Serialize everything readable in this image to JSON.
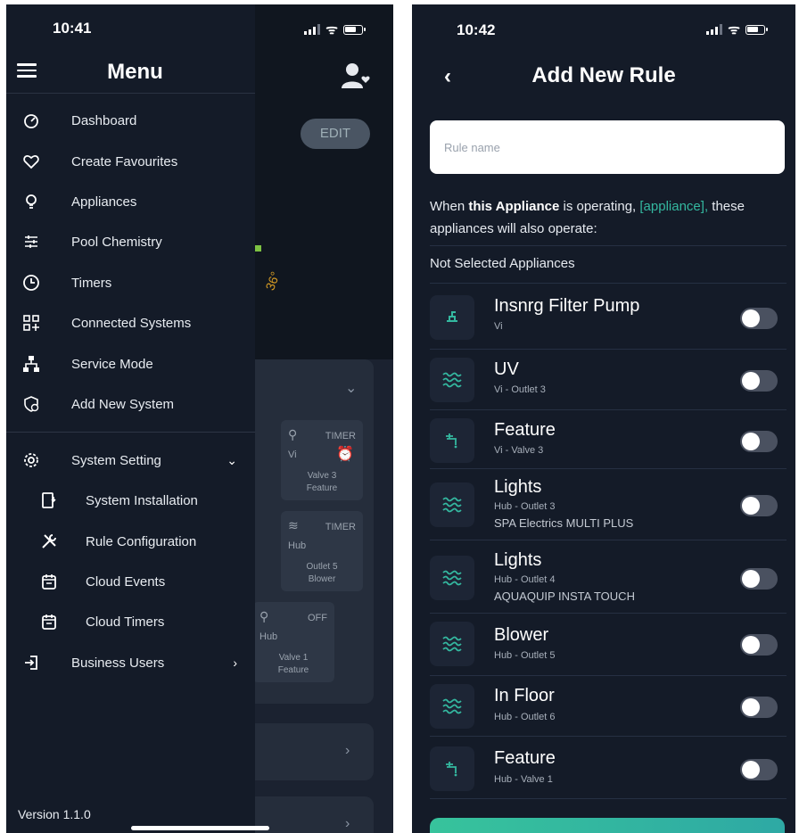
{
  "left_phone": {
    "status_time": "10:41",
    "menu": {
      "title": "Menu",
      "items": [
        {
          "label": "Dashboard",
          "icon": "dashboard-icon"
        },
        {
          "label": "Create Favourites",
          "icon": "heart-icon"
        },
        {
          "label": "Appliances",
          "icon": "lightbulb-icon"
        },
        {
          "label": "Pool Chemistry",
          "icon": "sliders-icon"
        },
        {
          "label": "Timers",
          "icon": "clock-icon"
        },
        {
          "label": "Connected Systems",
          "icon": "grid-plus-icon"
        },
        {
          "label": "Service Mode",
          "icon": "sitemap-icon"
        },
        {
          "label": "Add New System",
          "icon": "shield-plus-icon"
        }
      ],
      "system_setting": {
        "label": "System Setting",
        "icon": "gear-icon",
        "chevron": "chevron-down-icon"
      },
      "sub_items": [
        {
          "label": "System Installation",
          "icon": "device-install-icon"
        },
        {
          "label": "Rule Configuration",
          "icon": "tools-icon"
        },
        {
          "label": "Cloud Events",
          "icon": "calendar-icon"
        },
        {
          "label": "Cloud Timers",
          "icon": "calendar-icon"
        }
      ],
      "business_users": {
        "label": "Business Users",
        "icon": "login-icon",
        "chevron": "chevron-right-icon"
      },
      "version": "Version 1.1.0"
    },
    "background": {
      "edit_label": "EDIT",
      "temp_text": "36°",
      "tiles": [
        {
          "state": "TIMER",
          "system": "Vi",
          "name": "Valve 3",
          "desc": "Feature"
        },
        {
          "state": "TIMER",
          "system": "Hub",
          "name": "Outlet 5",
          "desc": "Blower"
        },
        {
          "state": "OFF",
          "system": "Hub",
          "name": "Valve 1",
          "desc": "Feature"
        }
      ]
    }
  },
  "right_phone": {
    "status_time": "10:42",
    "title": "Add New Rule",
    "rule_name_placeholder": "Rule name",
    "description": {
      "part1": "When ",
      "bold": "this Appliance",
      "part2": " is operating, ",
      "accent": "[appliance],",
      "part3": " these appliances will also operate:"
    },
    "section_title": "Not Selected Appliances",
    "appliances": [
      {
        "name": "Insnrg Filter Pump",
        "sub": "Vi",
        "sub2": "",
        "icon": "pump-icon",
        "on": false
      },
      {
        "name": "UV",
        "sub": "Vi - Outlet 3",
        "sub2": "",
        "icon": "waves-icon",
        "on": false
      },
      {
        "name": "Feature",
        "sub": "Vi - Valve 3",
        "sub2": "",
        "icon": "valve-icon",
        "on": false
      },
      {
        "name": "Lights",
        "sub": "Hub - Outlet 3",
        "sub2": "SPA Electrics MULTI PLUS",
        "icon": "waves-icon",
        "on": false
      },
      {
        "name": "Lights",
        "sub": "Hub - Outlet 4",
        "sub2": "AQUAQUIP INSTA TOUCH",
        "icon": "waves-icon",
        "on": false
      },
      {
        "name": "Blower",
        "sub": "Hub - Outlet 5",
        "sub2": "",
        "icon": "waves-icon",
        "on": false
      },
      {
        "name": "In Floor",
        "sub": "Hub - Outlet 6",
        "sub2": "",
        "icon": "waves-icon",
        "on": false
      },
      {
        "name": "Feature",
        "sub": "Hub - Valve 1",
        "sub2": "",
        "icon": "valve-icon",
        "on": false
      }
    ],
    "accent_color": "#34b8a0"
  }
}
